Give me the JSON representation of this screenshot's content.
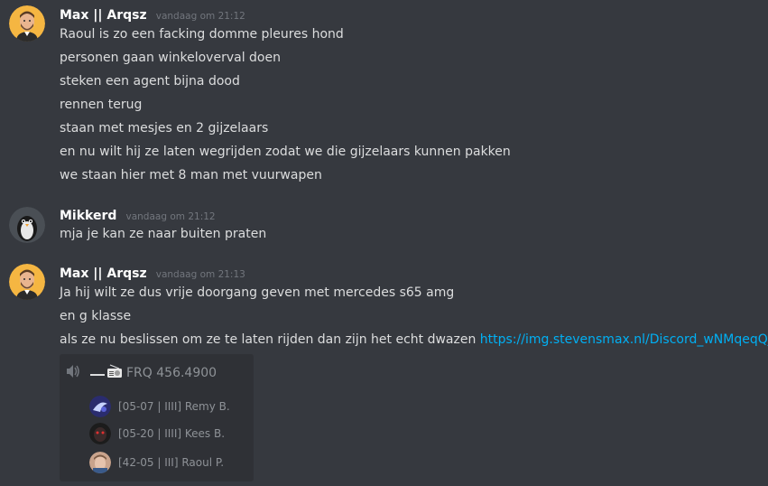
{
  "messages": [
    {
      "username": "Max || Arqsz",
      "timestamp": "vandaag om 21:12",
      "lines": [
        "Raoul is zo een facking domme pleures hond",
        "personen gaan winkeloverval doen",
        "steken een agent bijna dood",
        "rennen terug",
        "staan met mesjes en 2 gijzelaars",
        "en nu wilt hij ze laten wegrijden zodat we die gijzelaars kunnen pakken",
        "we staan hier met 8 man met vuurwapen"
      ]
    },
    {
      "username": "Mikkerd",
      "timestamp": "vandaag om 21:12",
      "lines": [
        "mja je kan ze naar buiten praten"
      ]
    },
    {
      "username": "Max || Arqsz",
      "timestamp": "vandaag om 21:13",
      "lines": [
        "Ja hij wilt ze dus vrije doorgang geven met mercedes s65 amg",
        "en g klasse"
      ],
      "last_line_text": "als ze nu beslissen om ze te laten rijden dan zijn het echt dwazen",
      "link": "https://img.stevensmax.nl/Discord_wNMqeqQjea.png"
    }
  ],
  "voice_embed": {
    "channel": "FRQ 456.4900",
    "members": [
      "[05-07 | IIII] Remy B.",
      "[05-20 | IIII] Kees B.",
      "[42-05 | III] Raoul P."
    ]
  },
  "colors": {
    "background": "#36393f",
    "username": "#ffffff",
    "text": "#dcddde",
    "timestamp": "#72767d",
    "link": "#00b0f4",
    "embed_bg": "#2f3136"
  }
}
